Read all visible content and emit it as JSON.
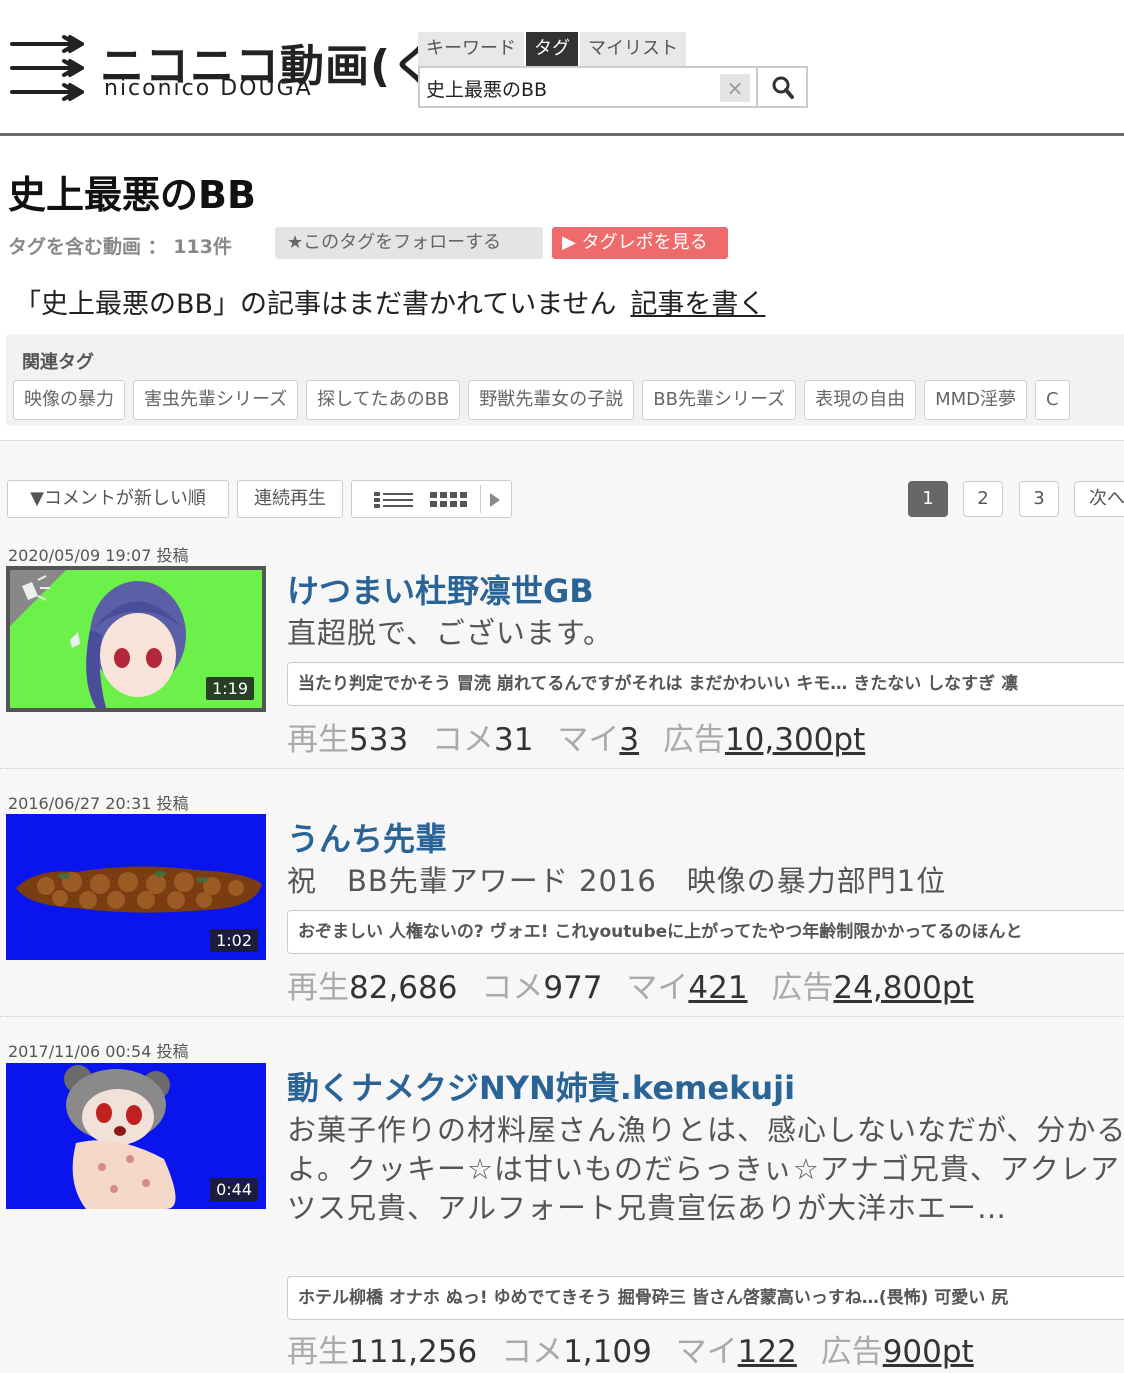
{
  "header": {
    "logo_main": "ニコニコ動画(く)",
    "logo_sub": "niconico DOUGA",
    "search_tabs": [
      "キーワード",
      "タグ",
      "マイリスト"
    ],
    "active_tab_index": 1,
    "search_value": "史上最悪のBB",
    "clear_label": "×"
  },
  "tag": {
    "title": "史上最悪のBB",
    "count_label": "タグを含む動画 ： 113件",
    "follow_label": "★このタグをフォローする",
    "report_label": "▶ タグレポを見る",
    "article_text": "「史上最悪のBB」の記事はまだ書かれていません",
    "article_link": "記事を書く"
  },
  "related": {
    "label": "関連タグ",
    "tags": [
      "映像の暴力",
      "害虫先輩シリーズ",
      "探してたあのBB",
      "野獣先輩女の子説",
      "BB先輩シリーズ",
      "表現の自由",
      "MMD淫夢",
      "C"
    ]
  },
  "toolbar": {
    "sort_label": "▼コメントが新しい順",
    "continuous_label": "連続再生",
    "pages": [
      "1",
      "2",
      "3"
    ],
    "active_page": "1",
    "next_label": "次へ"
  },
  "videos": [
    {
      "date": "2020/05/09 19:07  投稿",
      "duration": "1:19",
      "title": "けつまい杜野凛世GB",
      "description": "直超脱で、ございます。",
      "comments": "当たり判定でかそう 冒涜 崩れてるんですがそれは まだかわいい キモ… きたない しなすぎ 凛",
      "views_label": "再生",
      "views": "533",
      "comments_label": "コメ",
      "comment_count": "31",
      "mylist_label": "マイ",
      "mylist": "3",
      "ad_label": "広告",
      "ad": "10,300pt"
    },
    {
      "date": "2016/06/27 20:31  投稿",
      "duration": "1:02",
      "title": "うんち先輩",
      "description": "祝　BB先輩アワード 2016　映像の暴力部門1位",
      "comments": "おぞましい 人権ないの? ヴォエ! これyoutubeに上がってたやつ年齢制限かかってるのほんと",
      "views_label": "再生",
      "views": "82,686",
      "comments_label": "コメ",
      "comment_count": "977",
      "mylist_label": "マイ",
      "mylist": "421",
      "ad_label": "広告",
      "ad": "24,800pt"
    },
    {
      "date": "2017/11/06 00:54  投稿",
      "duration": "0:44",
      "title": "動くナメクジNYN姉貴.kemekuji",
      "description": "お菓子作りの材料屋さん漁りとは、感心しないなだが、分かるよ。クッキー☆は甘いものだらっきぃ☆アナゴ兄貴、アクレアツス兄貴、アルフォート兄貴宣伝ありが大洋ホエー…",
      "comments": "ホテル柳橋 オナホ ぬっ! ゆめでてきそう 掘骨砕三 皆さん啓蒙高いっすね…(畏怖) 可愛い 尻",
      "views_label": "再生",
      "views": "111,256",
      "comments_label": "コメ",
      "comment_count": "1,109",
      "mylist_label": "マイ",
      "mylist": "122",
      "ad_label": "広告",
      "ad": "900pt"
    }
  ],
  "colors": {
    "title_link": "#2a6496",
    "report_button": "#ef6b6b",
    "thumb_1_bg": "#6cf04a",
    "thumb_2_bg": "#0a14ec",
    "thumb_3_bg": "#0a14ec"
  },
  "icons": [
    "arrows-logo-icon",
    "search-icon",
    "list-view-icon",
    "grid-view-icon",
    "play-icon",
    "megaphone-icon"
  ]
}
